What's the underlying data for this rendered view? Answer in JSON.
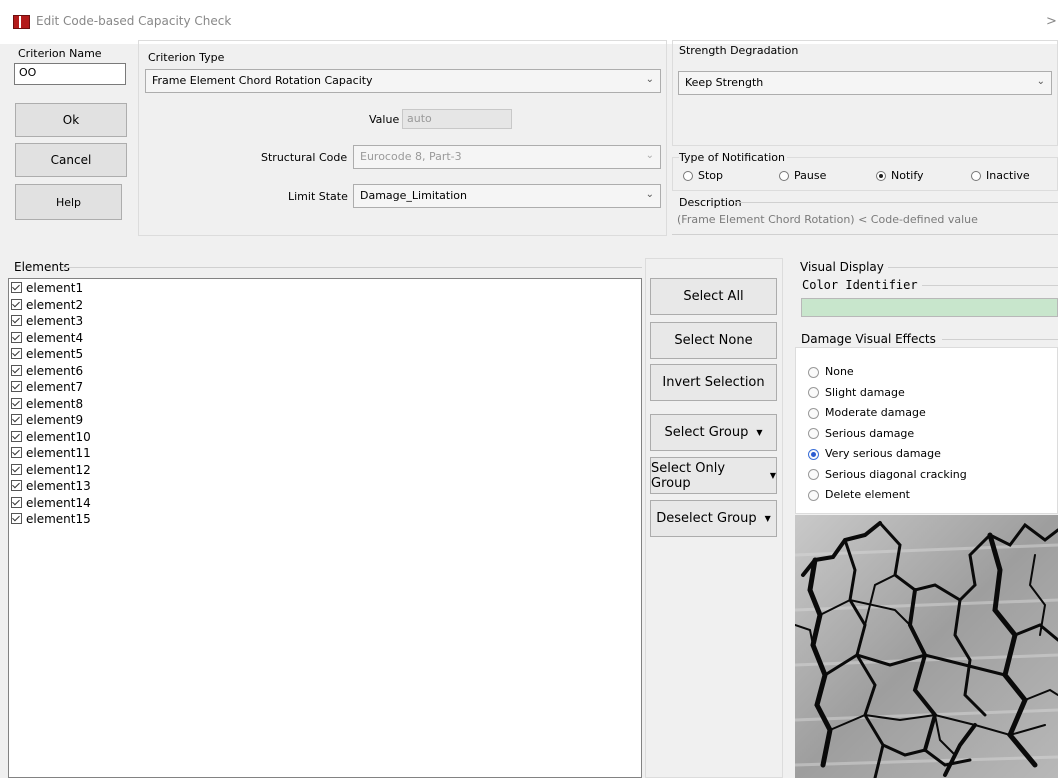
{
  "window": {
    "title": "Edit Code-based Capacity Check",
    "close": ">"
  },
  "criterion_name": {
    "label": "Criterion Name",
    "value": "OO"
  },
  "buttons": {
    "ok": "Ok",
    "cancel": "Cancel",
    "help": "Help"
  },
  "criterion_type": {
    "label": "Criterion Type",
    "selected": "Frame Element Chord Rotation Capacity",
    "value_label": "Value",
    "value": "auto",
    "structural_code_label": "Structural Code",
    "structural_code": "Eurocode 8, Part-3",
    "limit_state_label": "Limit State",
    "limit_state": "Damage_Limitation"
  },
  "strength_degradation": {
    "label": "Strength Degradation",
    "selected": "Keep Strength"
  },
  "notification": {
    "label": "Type of Notification",
    "options": [
      "Stop",
      "Pause",
      "Notify",
      "Inactive"
    ],
    "selected": "Notify"
  },
  "description": {
    "label": "Description",
    "text": "(Frame Element Chord Rotation) < Code-defined value"
  },
  "elements": {
    "label": "Elements",
    "items": [
      "element1",
      "element2",
      "element3",
      "element4",
      "element5",
      "element6",
      "element7",
      "element8",
      "element9",
      "element10",
      "element11",
      "element12",
      "element13",
      "element14",
      "element15"
    ],
    "checked": true
  },
  "selection_buttons": {
    "select_all": "Select All",
    "select_none": "Select None",
    "invert": "Invert Selection",
    "select_group": "Select Group",
    "select_only_group": "Select Only Group",
    "deselect_group": "Deselect Group"
  },
  "visual_display": {
    "label": "Visual Display",
    "color_identifier_label": "Color Identifier",
    "color": "#c8e6cc",
    "damage_label": "Damage Visual Effects",
    "damage_options": [
      "None",
      "Slight damage",
      "Moderate damage",
      "Serious damage",
      "Very serious damage",
      "Serious diagonal cracking",
      "Delete element"
    ],
    "damage_selected": "Very serious damage"
  }
}
